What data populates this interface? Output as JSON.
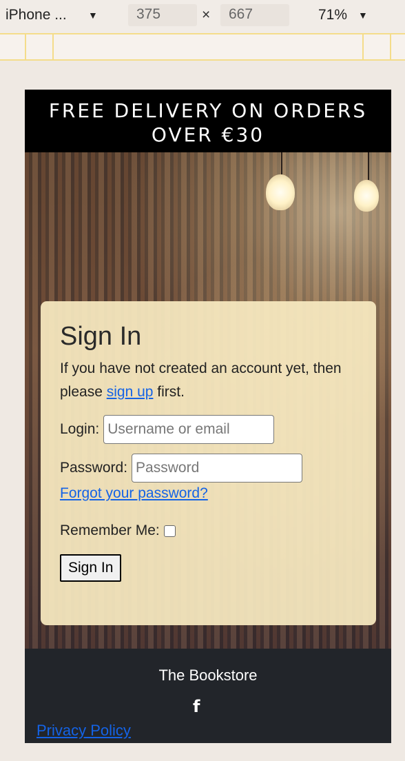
{
  "devtools": {
    "device": "iPhone ...",
    "width": "375",
    "times": "×",
    "height": "667",
    "zoom": "71%"
  },
  "banner": {
    "line1": "FREE DELIVERY ON ORDERS",
    "line2": "OVER €30"
  },
  "signin": {
    "title": "Sign In",
    "intro_before": "If you have not created an account yet, then please ",
    "signup_link": "sign up",
    "intro_after": " first.",
    "login_label": "Login:",
    "login_placeholder": "Username or email",
    "password_label": "Password:",
    "password_placeholder": "Password",
    "forgot_link": "Forgot your password?",
    "remember_label": "Remember Me:",
    "submit_label": "Sign In"
  },
  "footer": {
    "brand": "The Bookstore",
    "social_icon": "f",
    "privacy_link": "Privacy Policy"
  },
  "colors": {
    "link": "#1463e6",
    "card": "#f8e9c1",
    "footer": "#22252a"
  }
}
